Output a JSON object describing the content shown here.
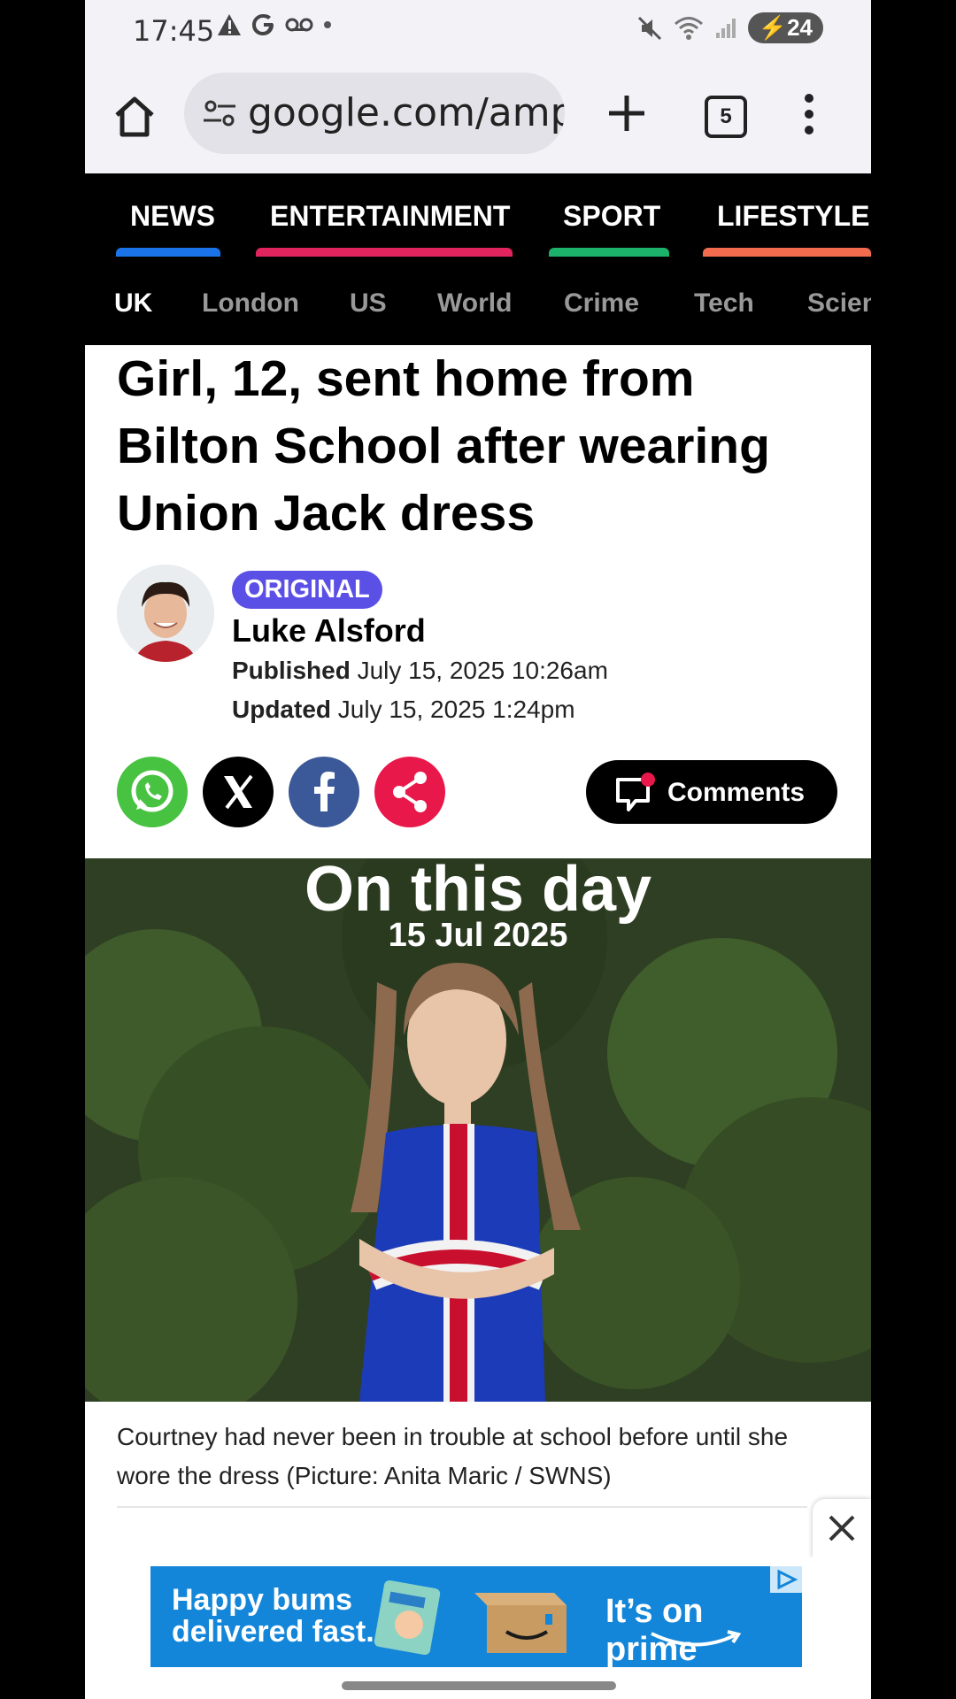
{
  "status_bar": {
    "time": "17:45",
    "battery": "24"
  },
  "browser": {
    "url": "google.com/amp/s",
    "tab_count": "5"
  },
  "site_nav": {
    "tabs": [
      {
        "label": "NEWS",
        "color": "#1a73e8"
      },
      {
        "label": "ENTERTAINMENT",
        "color": "#e0245e"
      },
      {
        "label": "SPORT",
        "color": "#1db26b"
      },
      {
        "label": "LIFESTYLE",
        "color": "#f26b4f"
      }
    ],
    "sub": [
      "UK",
      "London",
      "US",
      "World",
      "Crime",
      "Tech",
      "Scien"
    ]
  },
  "article": {
    "headline": "Girl, 12, sent home from Bilton School after wearing Union Jack dress",
    "badge": "ORIGINAL",
    "author": "Luke Alsford",
    "published_label": "Published",
    "published": "July 15, 2025 10:26am",
    "updated_label": "Updated",
    "updated": "July 15, 2025 1:24pm",
    "comments_label": "Comments"
  },
  "hero": {
    "overlay_title": "On this day",
    "overlay_date": "15 Jul 2025",
    "caption": "Courtney had never been in trouble at school before until she wore the dress (Picture: Anita Maric / SWNS)"
  },
  "ad": {
    "left_text_1": "Happy bums",
    "left_text_2": "delivered fast.",
    "right_text": "It’s on prime"
  }
}
